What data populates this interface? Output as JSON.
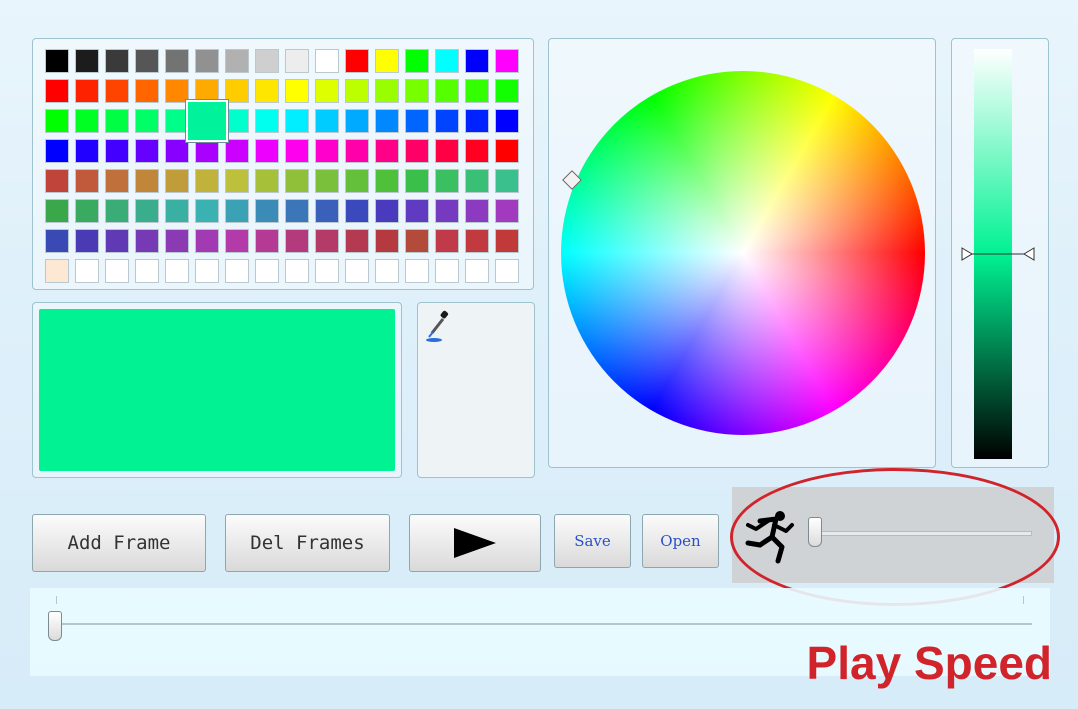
{
  "palette": {
    "rows": [
      [
        "#000000",
        "#1c1c1c",
        "#3a3a3a",
        "#565656",
        "#737373",
        "#919191",
        "#b1b1b1",
        "#cfcfcf",
        "#ededed",
        "#ffffff",
        "#ff0000",
        "#ffff00",
        "#00ff00",
        "#00ffff",
        "#0000ff",
        "#ff00ff"
      ],
      [
        "#ff0000",
        "#ff2200",
        "#ff4400",
        "#ff6600",
        "#ff8800",
        "#ffaa00",
        "#ffcc00",
        "#ffe600",
        "#ffff00",
        "#ddff00",
        "#bbff00",
        "#99ff00",
        "#77ff00",
        "#55ff00",
        "#33ff00",
        "#11ff00"
      ],
      [
        "#00ff00",
        "#00ff22",
        "#00ff44",
        "#00ff66",
        "#00ff88",
        "#00ffaa",
        "#00ffcc",
        "#00ffee",
        "#00eeff",
        "#00ccff",
        "#00aaff",
        "#0088ff",
        "#0066ff",
        "#0044ff",
        "#0022ff",
        "#0000ff"
      ],
      [
        "#0000ff",
        "#2200ff",
        "#4400ff",
        "#6600ff",
        "#8800ff",
        "#aa00ff",
        "#cc00ff",
        "#ee00ff",
        "#ff00ee",
        "#ff00cc",
        "#ff00aa",
        "#ff0088",
        "#ff0066",
        "#ff0044",
        "#ff0022",
        "#ff0000"
      ],
      [
        "#c0443a",
        "#c05a3a",
        "#c0703a",
        "#c0863a",
        "#c09c3a",
        "#c0b23a",
        "#bcc03a",
        "#a6c03a",
        "#90c03a",
        "#7ac03a",
        "#64c03a",
        "#4ec03a",
        "#3ac04a",
        "#3ac060",
        "#3ac076",
        "#3ac08c"
      ],
      [
        "#3aa84a",
        "#3aaa60",
        "#3aac76",
        "#3aae8c",
        "#3ab0a2",
        "#3ab2b2",
        "#3aa2b4",
        "#3a8cb6",
        "#3a76b8",
        "#3a60ba",
        "#3a4abc",
        "#4a3abe",
        "#603ac0",
        "#763ac0",
        "#8c3ac0",
        "#a23ac0"
      ],
      [
        "#3a4ab4",
        "#4a3ab4",
        "#603ab4",
        "#763ab4",
        "#8c3ab4",
        "#a23ab4",
        "#b43aaa",
        "#b43a94",
        "#b43a7e",
        "#b43a68",
        "#b43a52",
        "#b43a40",
        "#b44a3a",
        "#c03a4a",
        "#c03a40",
        "#c03a3a"
      ],
      [
        "#fde8d4",
        "#ffffff",
        "#ffffff",
        "#ffffff",
        "#ffffff",
        "#ffffff",
        "#ffffff",
        "#ffffff",
        "#ffffff",
        "#ffffff",
        "#ffffff",
        "#ffffff",
        "#ffffff",
        "#ffffff",
        "#ffffff",
        "#ffffff"
      ]
    ],
    "selected_row": 2,
    "selected_col": 5,
    "selected_color": "#00f29a"
  },
  "preview": {
    "color": "#00f293"
  },
  "eyedropper": {
    "icon": "eyedropper-icon"
  },
  "wheel": {
    "icon": "color-wheel"
  },
  "brightness": {
    "level": 0.5
  },
  "toolbar": {
    "add_frame_label": "Add Frame",
    "del_frames_label": "Del Frames",
    "play_icon": "play-icon",
    "save_label": "Save",
    "open_label": "Open"
  },
  "speed": {
    "icon": "running-man-icon",
    "value": 0.0
  },
  "timeline": {
    "value": 0.0
  },
  "annotation": {
    "label": "Play Speed",
    "color": "#d1242a"
  }
}
